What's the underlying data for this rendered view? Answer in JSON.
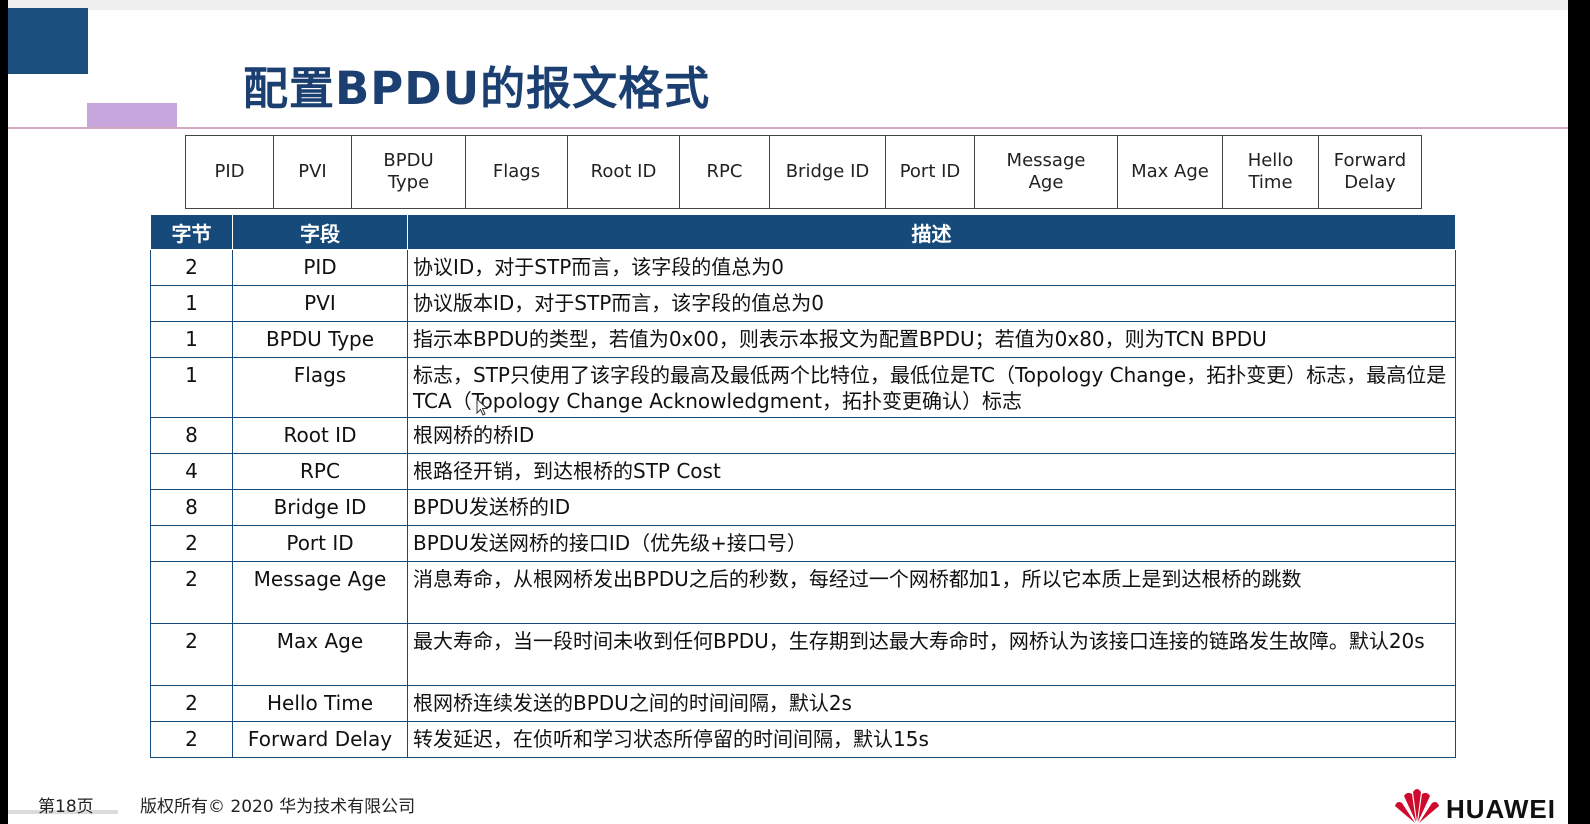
{
  "title": "配置BPDU的报文格式",
  "frame_fields": [
    "PID",
    "PVI",
    "BPDU\nType",
    "Flags",
    "Root ID",
    "RPC",
    "Bridge ID",
    "Port ID",
    "Message\nAge",
    "Max Age",
    "Hello\nTime",
    "Forward\nDelay"
  ],
  "table": {
    "headers": [
      "字节",
      "字段",
      "描述"
    ],
    "rows": [
      {
        "bytes": "2",
        "field": "PID",
        "desc": "协议ID，对于STP而言，该字段的值总为0"
      },
      {
        "bytes": "1",
        "field": "PVI",
        "desc": "协议版本ID，对于STP而言，该字段的值总为0"
      },
      {
        "bytes": "1",
        "field": "BPDU Type",
        "desc": "指示本BPDU的类型，若值为0x00，则表示本报文为配置BPDU；若值为0x80，则为TCN BPDU"
      },
      {
        "bytes": "1",
        "field": "Flags",
        "desc": "标志，STP只使用了该字段的最高及最低两个比特位，最低位是TC（Topology Change，拓扑变更）标志，最高位是TCA（Topology Change Acknowledgment，拓扑变更确认）标志"
      },
      {
        "bytes": "8",
        "field": "Root ID",
        "desc": "根网桥的桥ID"
      },
      {
        "bytes": "4",
        "field": "RPC",
        "desc": "根路径开销，到达根桥的STP Cost"
      },
      {
        "bytes": "8",
        "field": "Bridge ID",
        "desc": "BPDU发送桥的ID"
      },
      {
        "bytes": "2",
        "field": "Port ID",
        "desc": "BPDU发送网桥的接口ID（优先级+接口号）"
      },
      {
        "bytes": "2",
        "field": "Message Age",
        "desc": "消息寿命，从根网桥发出BPDU之后的秒数，每经过一个网桥都加1，所以它本质上是到达根桥的跳数"
      },
      {
        "bytes": "2",
        "field": "Max Age",
        "desc": "最大寿命，当一段时间未收到任何BPDU，生存期到达最大寿命时，网桥认为该接口连接的链路发生故障。默认20s"
      },
      {
        "bytes": "2",
        "field": "Hello Time",
        "desc": "根网桥连续发送的BPDU之间的时间间隔，默认2s"
      },
      {
        "bytes": "2",
        "field": "Forward Delay",
        "desc": "转发延迟，在侦听和学习状态所停留的时间间隔，默认15s"
      }
    ]
  },
  "footer": {
    "page": "第18页",
    "copyright": "版权所有© 2020 华为技术有限公司",
    "logo_text": "HUAWEI"
  },
  "colors": {
    "title": "#1b3f70",
    "header_bg": "#164a7a",
    "accent_blue": "#1b4f7d",
    "accent_purple": "#c6a6dc",
    "logo_red": "#cf0a2c"
  }
}
